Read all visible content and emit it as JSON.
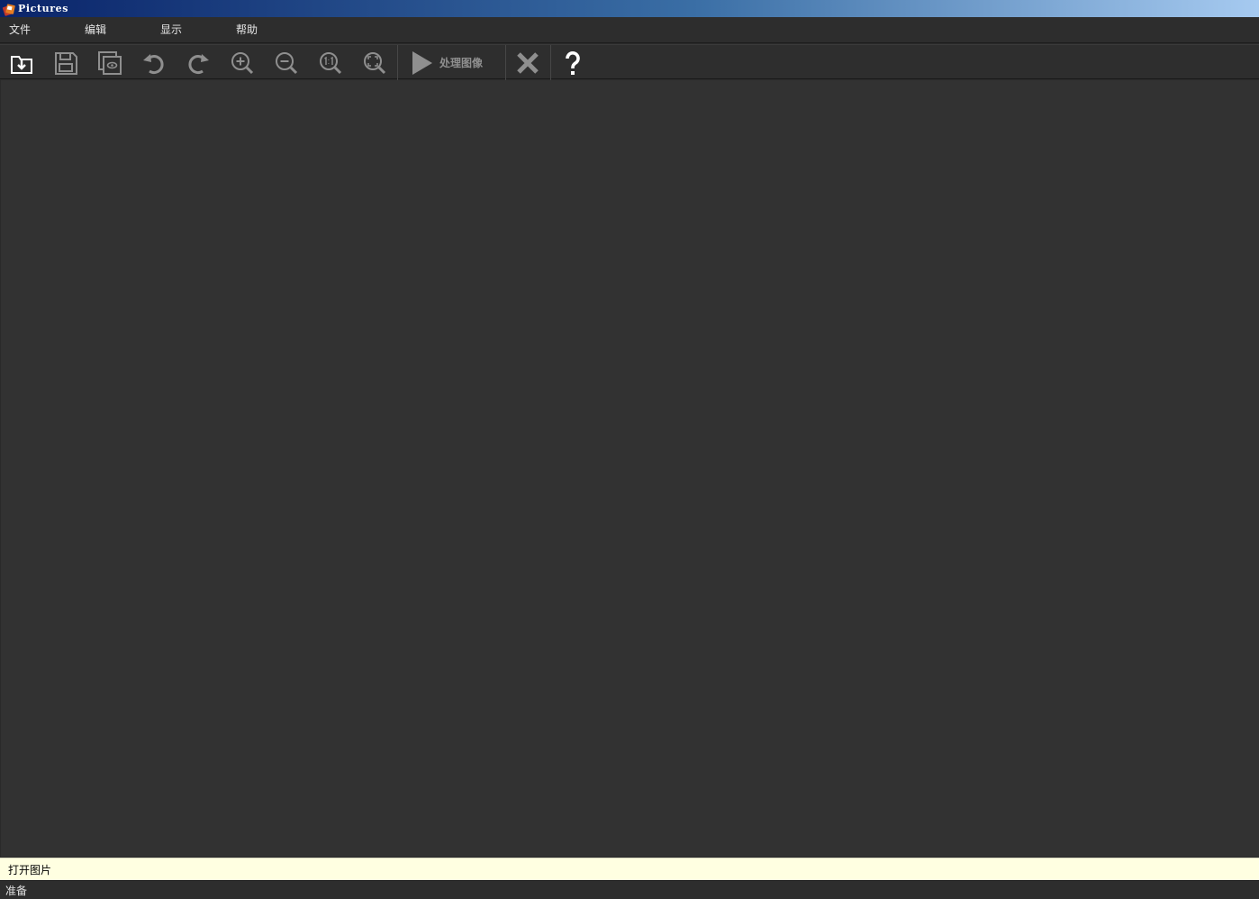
{
  "window": {
    "title": "Pictures",
    "icon": "app-icon"
  },
  "menu": {
    "items": [
      {
        "label": "文件"
      },
      {
        "label": "编辑"
      },
      {
        "label": "显示"
      },
      {
        "label": "帮助"
      }
    ]
  },
  "toolbar": {
    "icons": [
      "open-image-icon",
      "save-icon",
      "preview-icon",
      "undo-icon",
      "redo-icon",
      "zoom-in-icon",
      "zoom-out-icon",
      "actual-size-icon",
      "fit-window-icon",
      "play-icon",
      "close-icon",
      "help-icon"
    ],
    "process_label": "处理图像"
  },
  "hint": {
    "text": "打开图片"
  },
  "status": {
    "text": "准备"
  },
  "colors": {
    "title_gradient_start": "#0a246a",
    "title_gradient_end": "#a6caf0",
    "background": "#2b2b2b",
    "canvas": "#323232",
    "hint_bar": "#ffffe1",
    "icon_gray": "#8f8f8f"
  }
}
